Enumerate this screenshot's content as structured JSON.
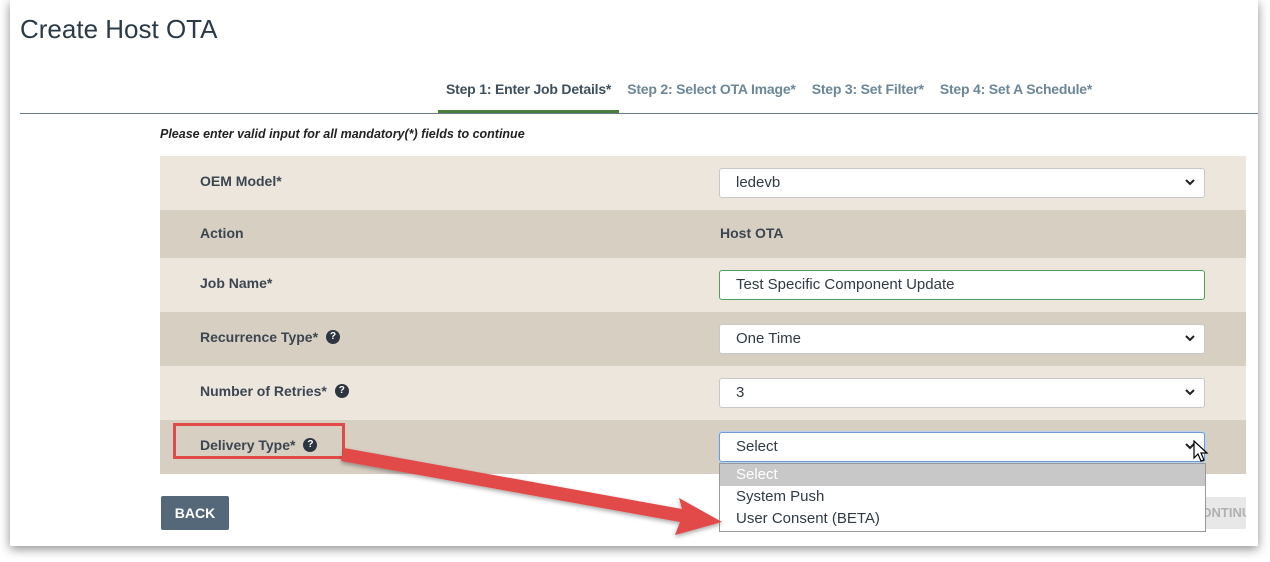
{
  "page": {
    "title": "Create Host OTA"
  },
  "steps": [
    {
      "label": "Step 1: Enter Job Details*",
      "active": true
    },
    {
      "label": "Step 2: Select OTA Image*",
      "active": false
    },
    {
      "label": "Step 3: Set Filter*",
      "active": false
    },
    {
      "label": "Step 4: Set A Schedule*",
      "active": false
    }
  ],
  "form": {
    "warning": "Please enter valid input for all mandatory(*) fields to continue",
    "oem_model": {
      "label": "OEM Model*",
      "value": "ledevb"
    },
    "action": {
      "label": "Action",
      "value": "Host OTA"
    },
    "job_name": {
      "label": "Job Name*",
      "value": "Test Specific Component Update"
    },
    "recurrence_type": {
      "label": "Recurrence Type*",
      "value": "One Time"
    },
    "retries": {
      "label": "Number of Retries*",
      "value": "3"
    },
    "delivery_type": {
      "label": "Delivery Type*",
      "value": "Select",
      "options": [
        "Select",
        "System Push",
        "User Consent (BETA)"
      ]
    }
  },
  "buttons": {
    "back": "BACK",
    "continue": "CONTINUE"
  },
  "icons": {
    "help": "question-circle-icon",
    "chevron": "chevron-down-icon"
  },
  "colors": {
    "annotation": "#e24a4a",
    "active_step": "#4a7c3e",
    "back_button": "#54687a"
  }
}
